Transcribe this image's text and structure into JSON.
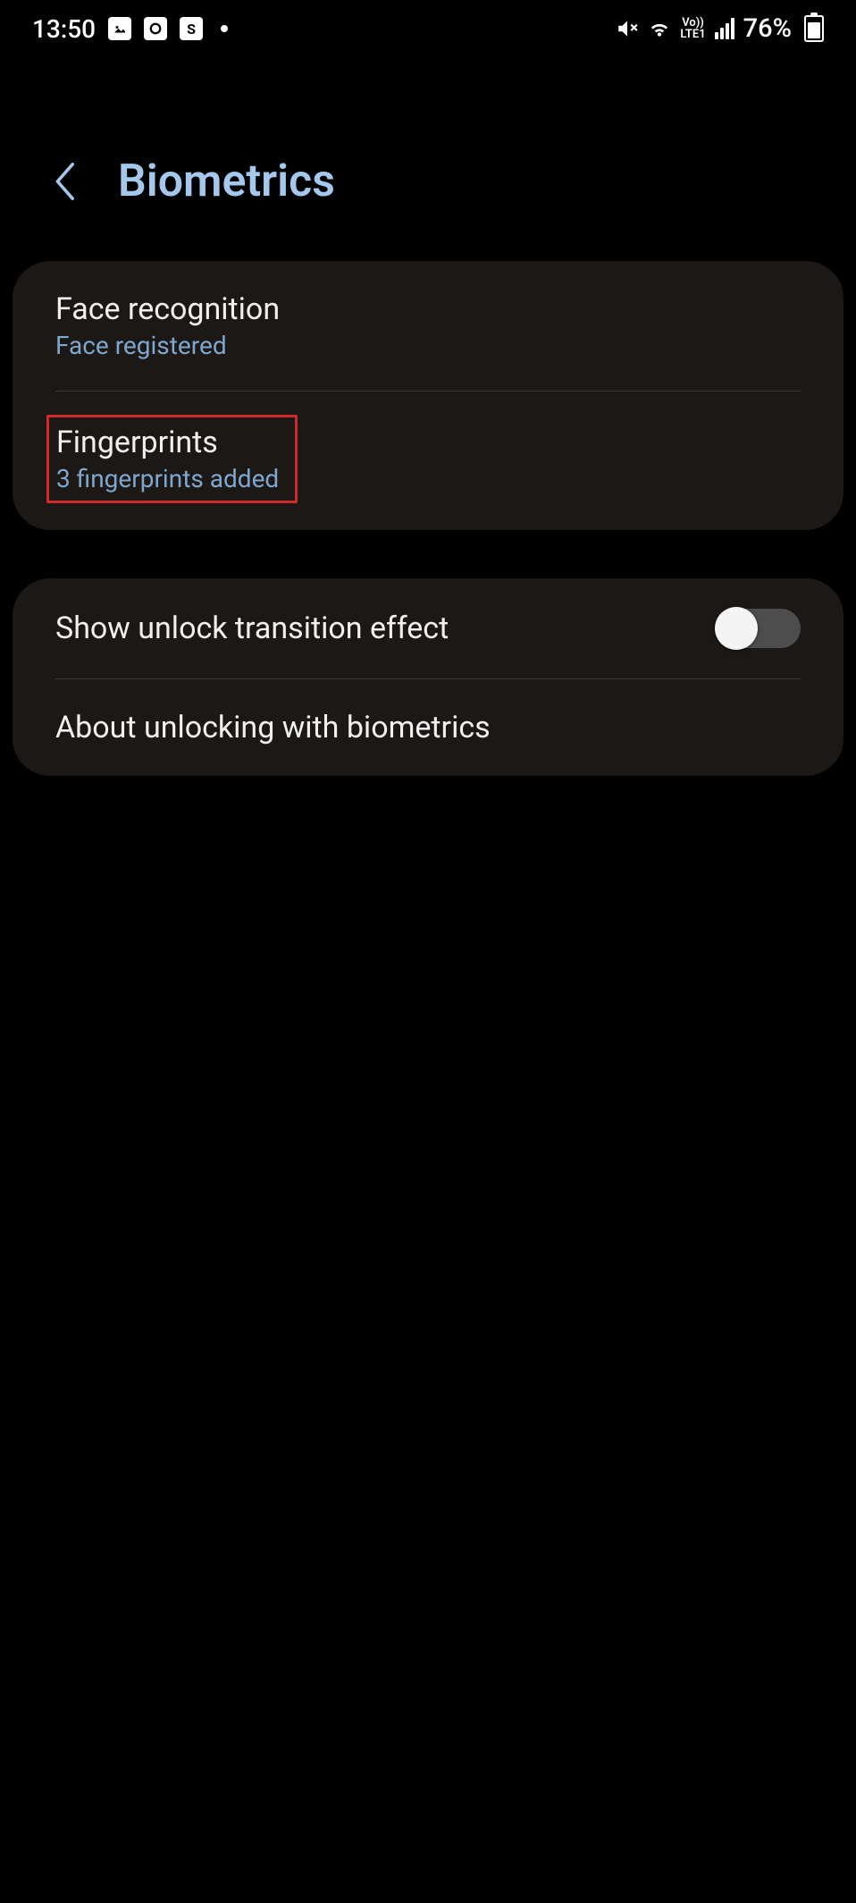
{
  "status": {
    "time": "13:50",
    "battery_pct": "76%",
    "volte": "Vo))\nLTE1"
  },
  "header": {
    "title": "Biometrics"
  },
  "items": {
    "face": {
      "label": "Face recognition",
      "sub": "Face registered"
    },
    "finger": {
      "label": "Fingerprints",
      "sub": "3 fingerprints added"
    },
    "transition": {
      "label": "Show unlock transition effect",
      "toggle_on": false
    },
    "about": {
      "label": "About unlocking with biometrics"
    }
  }
}
